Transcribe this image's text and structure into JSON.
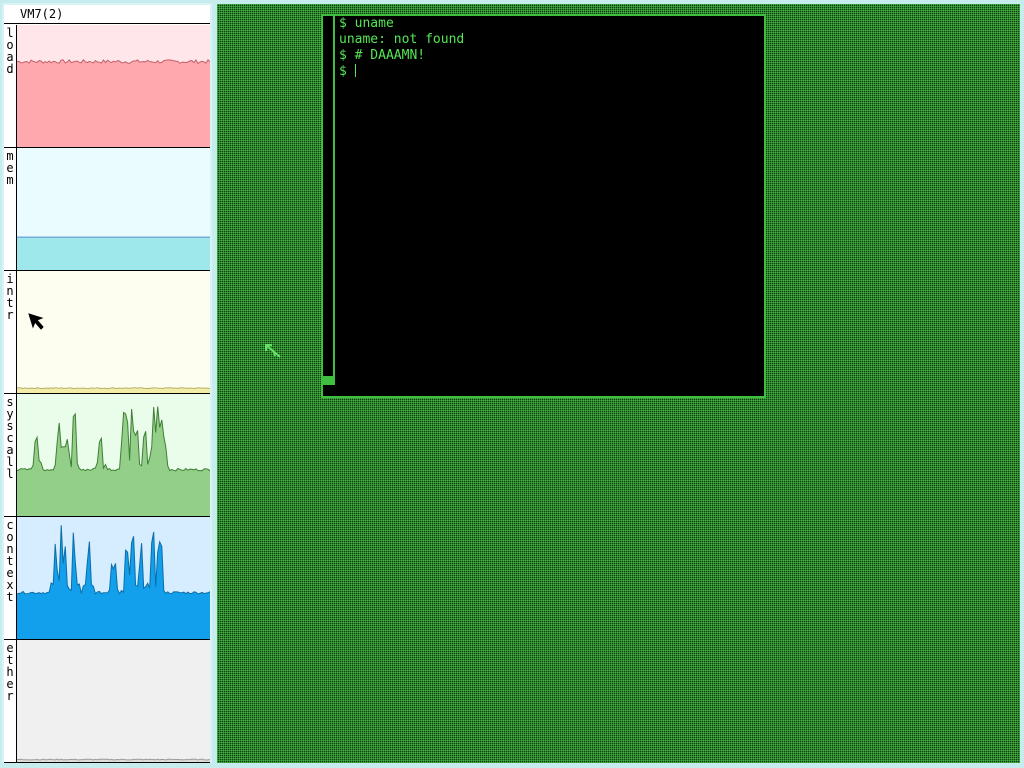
{
  "stats": {
    "title": "VM7(2)",
    "panels": [
      {
        "label": "load",
        "bg": "#ffe6ea",
        "fill": "#ffa8ae",
        "line": "#c4606a",
        "level": 0.7,
        "spikes": [],
        "jitter": 0.015
      },
      {
        "label": "mem",
        "bg": "#eafcff",
        "fill": "#9ee8ec",
        "line": "#5a8bd0",
        "level": 0.27,
        "spikes": [],
        "jitter": 0.0
      },
      {
        "label": "intr",
        "bg": "#fefef0",
        "fill": "#f2eeaa",
        "line": "#b8b066",
        "level": 0.04,
        "spikes": [],
        "jitter": 0.004
      },
      {
        "label": "syscall",
        "bg": "#eafcea",
        "fill": "#94cf8a",
        "line": "#3f7f35",
        "level": 0.38,
        "spikes": [
          0.1,
          0.22,
          0.25,
          0.3,
          0.43,
          0.55,
          0.57,
          0.6,
          0.62,
          0.66,
          0.7,
          0.73,
          0.76
        ],
        "jitter": 0.01
      },
      {
        "label": "context",
        "bg": "#d6ecff",
        "fill": "#12a0ec",
        "line": "#0b6ea8",
        "level": 0.38,
        "spikes": [
          0.2,
          0.24,
          0.3,
          0.37,
          0.5,
          0.57,
          0.6,
          0.64,
          0.7,
          0.74
        ],
        "jitter": 0.01
      },
      {
        "label": "ether",
        "bg": "#f0f0f0",
        "fill": "#dddddd",
        "line": "#9a9a9a",
        "level": 0.02,
        "spikes": [],
        "jitter": 0.004
      }
    ]
  },
  "terminal": {
    "lines": [
      "$ uname",
      "uname: not found",
      "$ # DAAAMN!",
      "$ "
    ],
    "text_color": "#55e655",
    "border_color": "#3fbf3f"
  },
  "desktop": {
    "pattern_color": "#2d8a2d"
  }
}
